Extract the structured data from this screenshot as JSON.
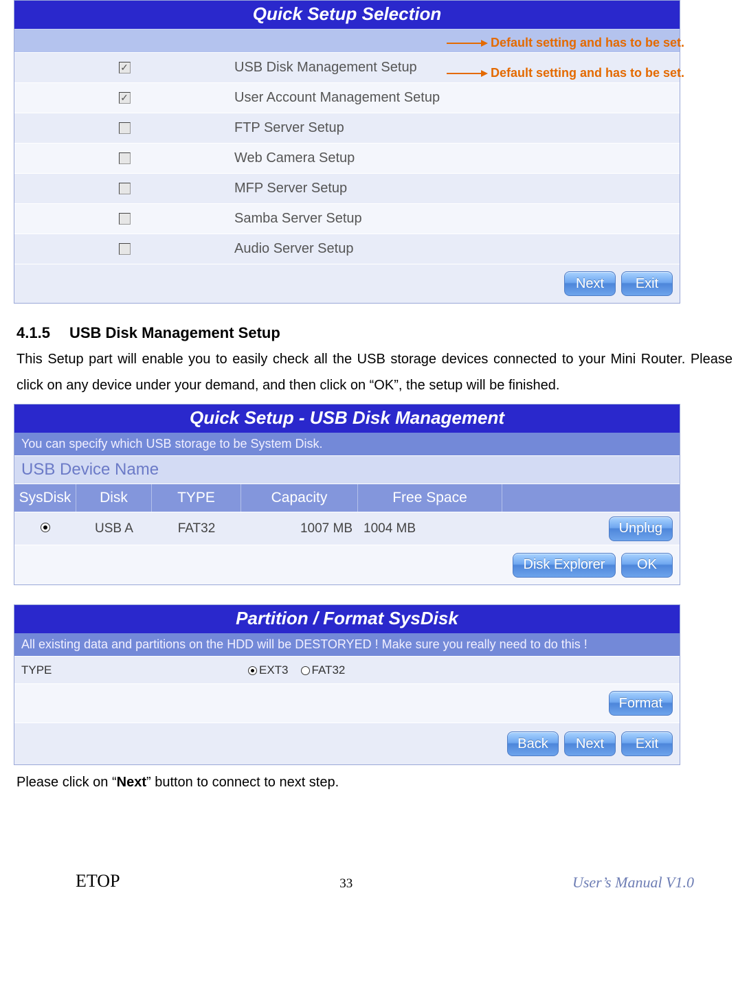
{
  "panel1": {
    "title": "Quick Setup Selection",
    "rows": [
      {
        "label": "USB Disk Management Setup",
        "checked": true
      },
      {
        "label": "User Account Management Setup",
        "checked": true
      },
      {
        "label": "FTP Server Setup",
        "checked": false
      },
      {
        "label": "Web Camera Setup",
        "checked": false
      },
      {
        "label": "MFP Server Setup",
        "checked": false
      },
      {
        "label": "Samba Server Setup",
        "checked": false
      },
      {
        "label": "Audio Server Setup",
        "checked": false
      }
    ],
    "buttons": {
      "next": "Next",
      "exit": "Exit"
    },
    "annotation": "Default setting and has to be set."
  },
  "section": {
    "number": "4.1.5",
    "title": "USB Disk Management Setup",
    "para": "This Setup part will enable you to easily check all the USB storage devices connected to your Mini Router. Please click on any device under your demand, and then click on “OK”, the setup will be finished."
  },
  "panel2": {
    "title": "Quick Setup - USB Disk Management",
    "desc": "You can specify which USB storage to be System Disk.",
    "subheader": "USB Device Name",
    "columns": {
      "sysdisk": "SysDisk",
      "disk": "Disk",
      "type": "TYPE",
      "capacity": "Capacity",
      "free": "Free Space"
    },
    "row": {
      "selected": true,
      "disk": "USB A",
      "type": "FAT32",
      "capacity": "1007 MB",
      "free": "1004 MB",
      "unplug": "Unplug"
    },
    "buttons": {
      "explorer": "Disk Explorer",
      "ok": "OK"
    }
  },
  "panel3": {
    "title": "Partition / Format SysDisk",
    "desc": "All existing data and partitions on the HDD will be DESTORYED ! Make sure you really need to do this !",
    "type_label": "TYPE",
    "options": {
      "ext3": "EXT3",
      "fat32": "FAT32"
    },
    "selected": "ext3",
    "buttons": {
      "format": "Format",
      "back": "Back",
      "next": "Next",
      "exit": "Exit"
    }
  },
  "closing": {
    "pre": "Please click on “",
    "b": "Next",
    "post": "” button to connect to next step."
  },
  "footer": {
    "brand": "ETOP",
    "page": "33",
    "manual": "User’s Manual V1.0"
  }
}
